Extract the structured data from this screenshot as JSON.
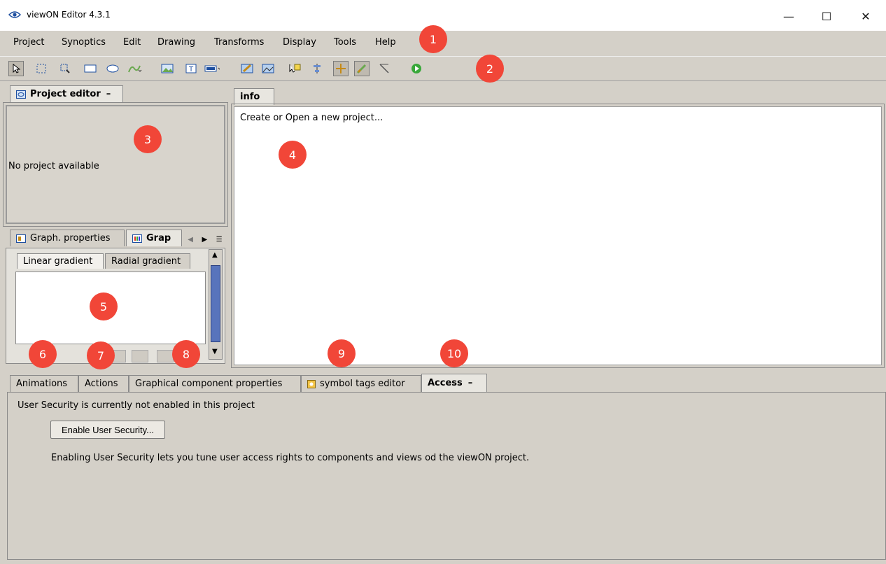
{
  "window": {
    "title": "viewON Editor  4.3.1",
    "controls": {
      "minimize": "—",
      "maximize": "☐",
      "close": "✕"
    }
  },
  "menubar": {
    "items": [
      "Project",
      "Synoptics",
      "Edit",
      "Drawing",
      "Transforms",
      "Display",
      "Tools",
      "Help"
    ]
  },
  "toolbar": {
    "buttons": [
      "select-arrow-icon",
      "marquee-select-icon",
      "zoom-select-icon",
      "rectangle-icon",
      "ellipse-icon",
      "curve-icon",
      "image-icon",
      "text-icon",
      "widget-icon",
      "edit-image-icon",
      "image-props-icon",
      "pick-icon",
      "align-icon",
      "guides-icon",
      "pen-icon",
      "line-icon",
      "run-icon"
    ],
    "accent": "#f14638"
  },
  "project_editor": {
    "tab_label": "Project editor",
    "minimize": "–",
    "empty_text": "No project available"
  },
  "info": {
    "tab_label": "info",
    "text": "Create or Open a new project..."
  },
  "graph_panel": {
    "tabs": [
      "Graph. properties",
      "Grap"
    ],
    "gradient_tabs": [
      "Linear gradient",
      "Radial gradient"
    ]
  },
  "bottom_tabs": {
    "items": [
      "Animations",
      "Actions",
      "Graphical component properties",
      "symbol tags editor",
      "Access"
    ],
    "active": "Access",
    "minimize": "–"
  },
  "access": {
    "status": "User Security is currently not enabled in this project",
    "button": "Enable User Security...",
    "description": "Enabling User Security lets you tune user access rights to components and views od the viewON project."
  },
  "callouts": [
    "1",
    "2",
    "3",
    "4",
    "5",
    "6",
    "7",
    "8",
    "9",
    "10"
  ]
}
